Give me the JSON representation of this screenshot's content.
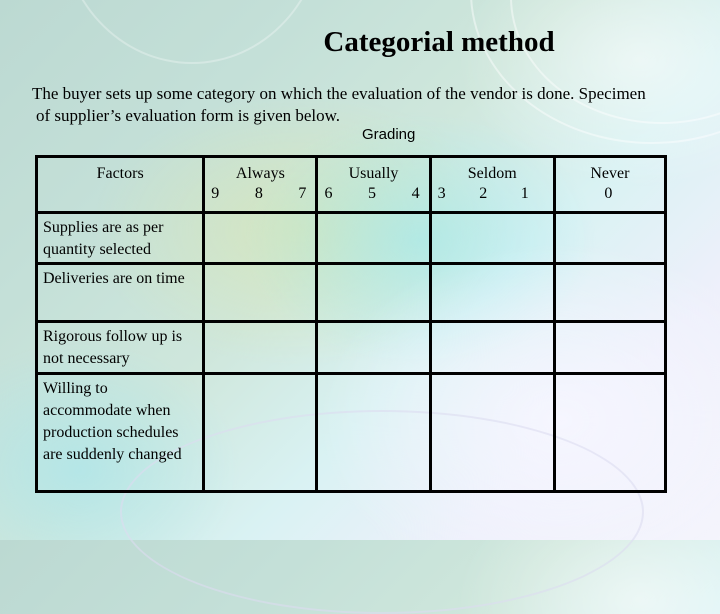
{
  "slide": {
    "title": "Categorial method",
    "intro_line1": "The buyer sets up some category on which the evaluation of the vendor is done. Specimen",
    "intro_line2": "of supplier’s evaluation form is given below.",
    "grading_label": "Grading"
  },
  "table": {
    "factors_header": "Factors",
    "categories": [
      {
        "label": "Always",
        "scores": [
          "9",
          "8",
          "7"
        ]
      },
      {
        "label": "Usually",
        "scores": [
          "6",
          "5",
          "4"
        ]
      },
      {
        "label": "Seldom",
        "scores": [
          "3",
          "2",
          "1"
        ]
      },
      {
        "label": "Never",
        "scores": [
          "0"
        ]
      }
    ],
    "rows": [
      {
        "factor": "Supplies are as per quantity selected",
        "grades": [
          "",
          "",
          "",
          ""
        ]
      },
      {
        "factor": "Deliveries are on time",
        "grades": [
          "",
          "",
          "",
          ""
        ]
      },
      {
        "factor": "Rigorous follow up is not necessary",
        "grades": [
          "",
          "",
          "",
          ""
        ]
      },
      {
        "factor": "Willing to accommodate when production schedules are suddenly changed",
        "grades": [
          "",
          "",
          "",
          ""
        ]
      }
    ]
  }
}
